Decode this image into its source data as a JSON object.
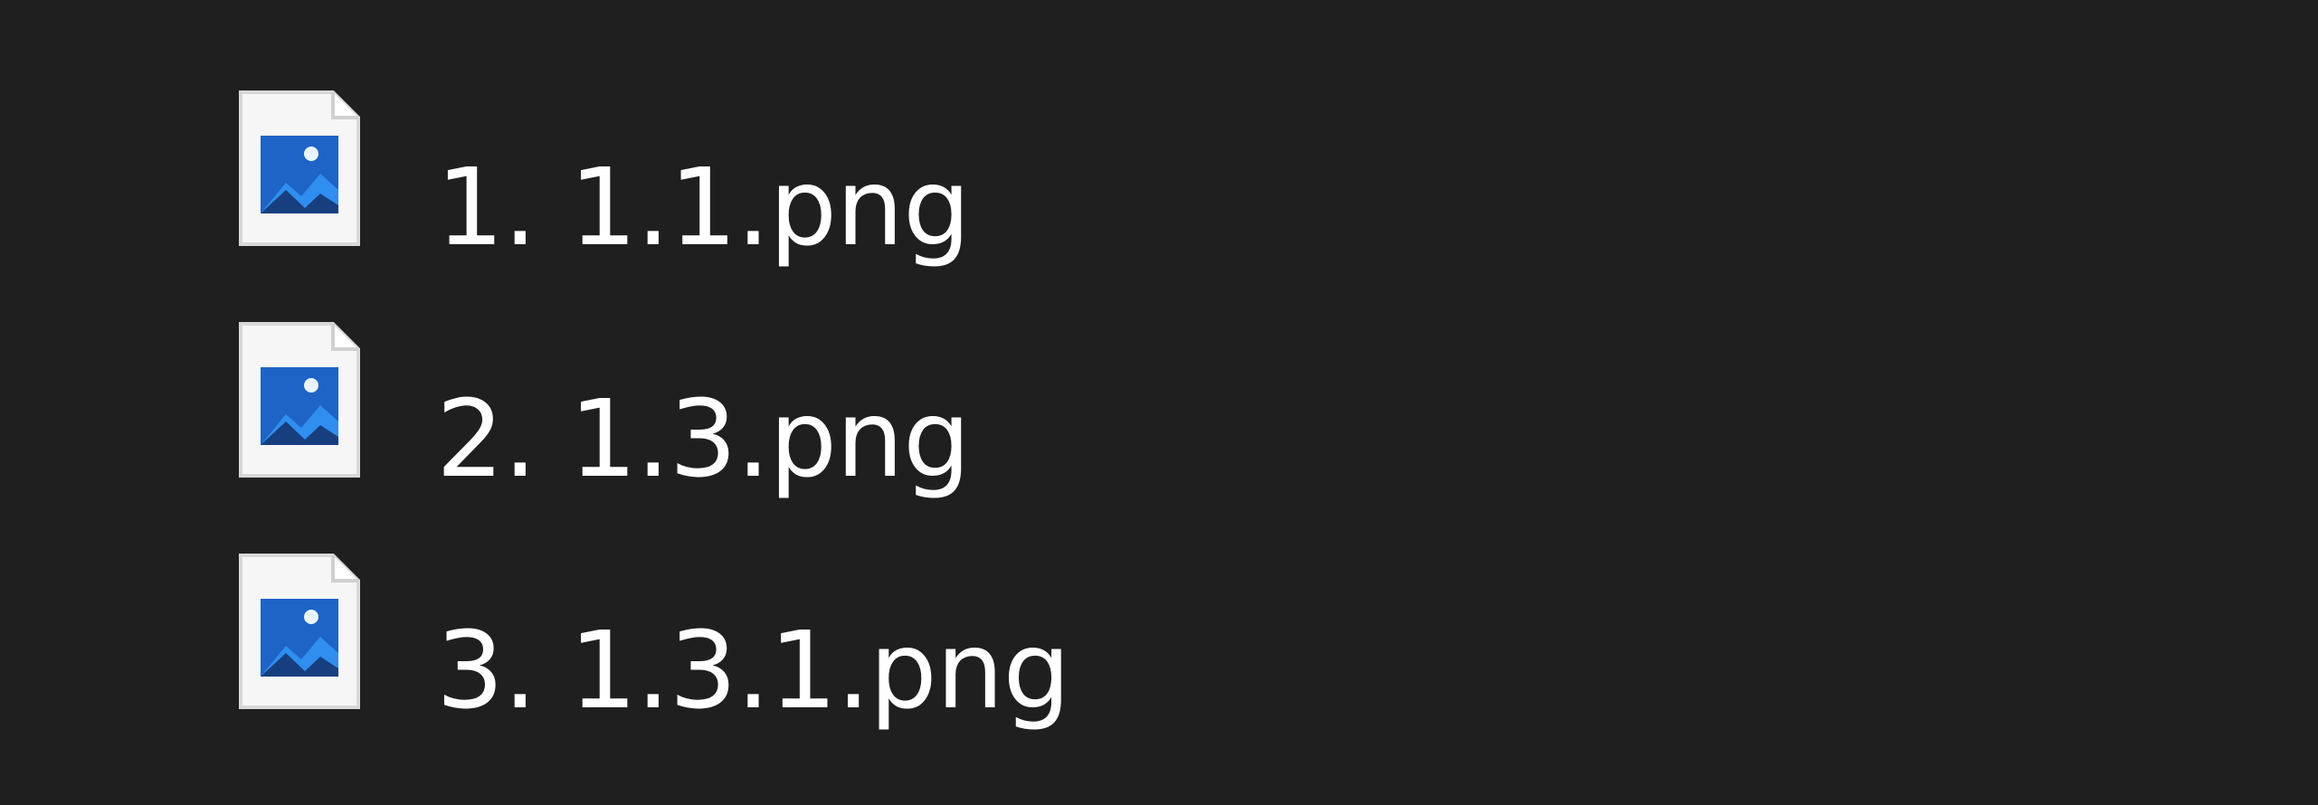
{
  "files": [
    {
      "name": "1. 1.1.png",
      "icon": "image-file-icon"
    },
    {
      "name": "2. 1.3.png",
      "icon": "image-file-icon"
    },
    {
      "name": "3. 1.3.1.png",
      "icon": "image-file-icon"
    }
  ],
  "colors": {
    "background": "#1f1f1f",
    "text": "#ffffff",
    "icon_page": "#f4f4f4",
    "icon_blue_light": "#2f86ea",
    "icon_blue_dark": "#1c4d93"
  }
}
